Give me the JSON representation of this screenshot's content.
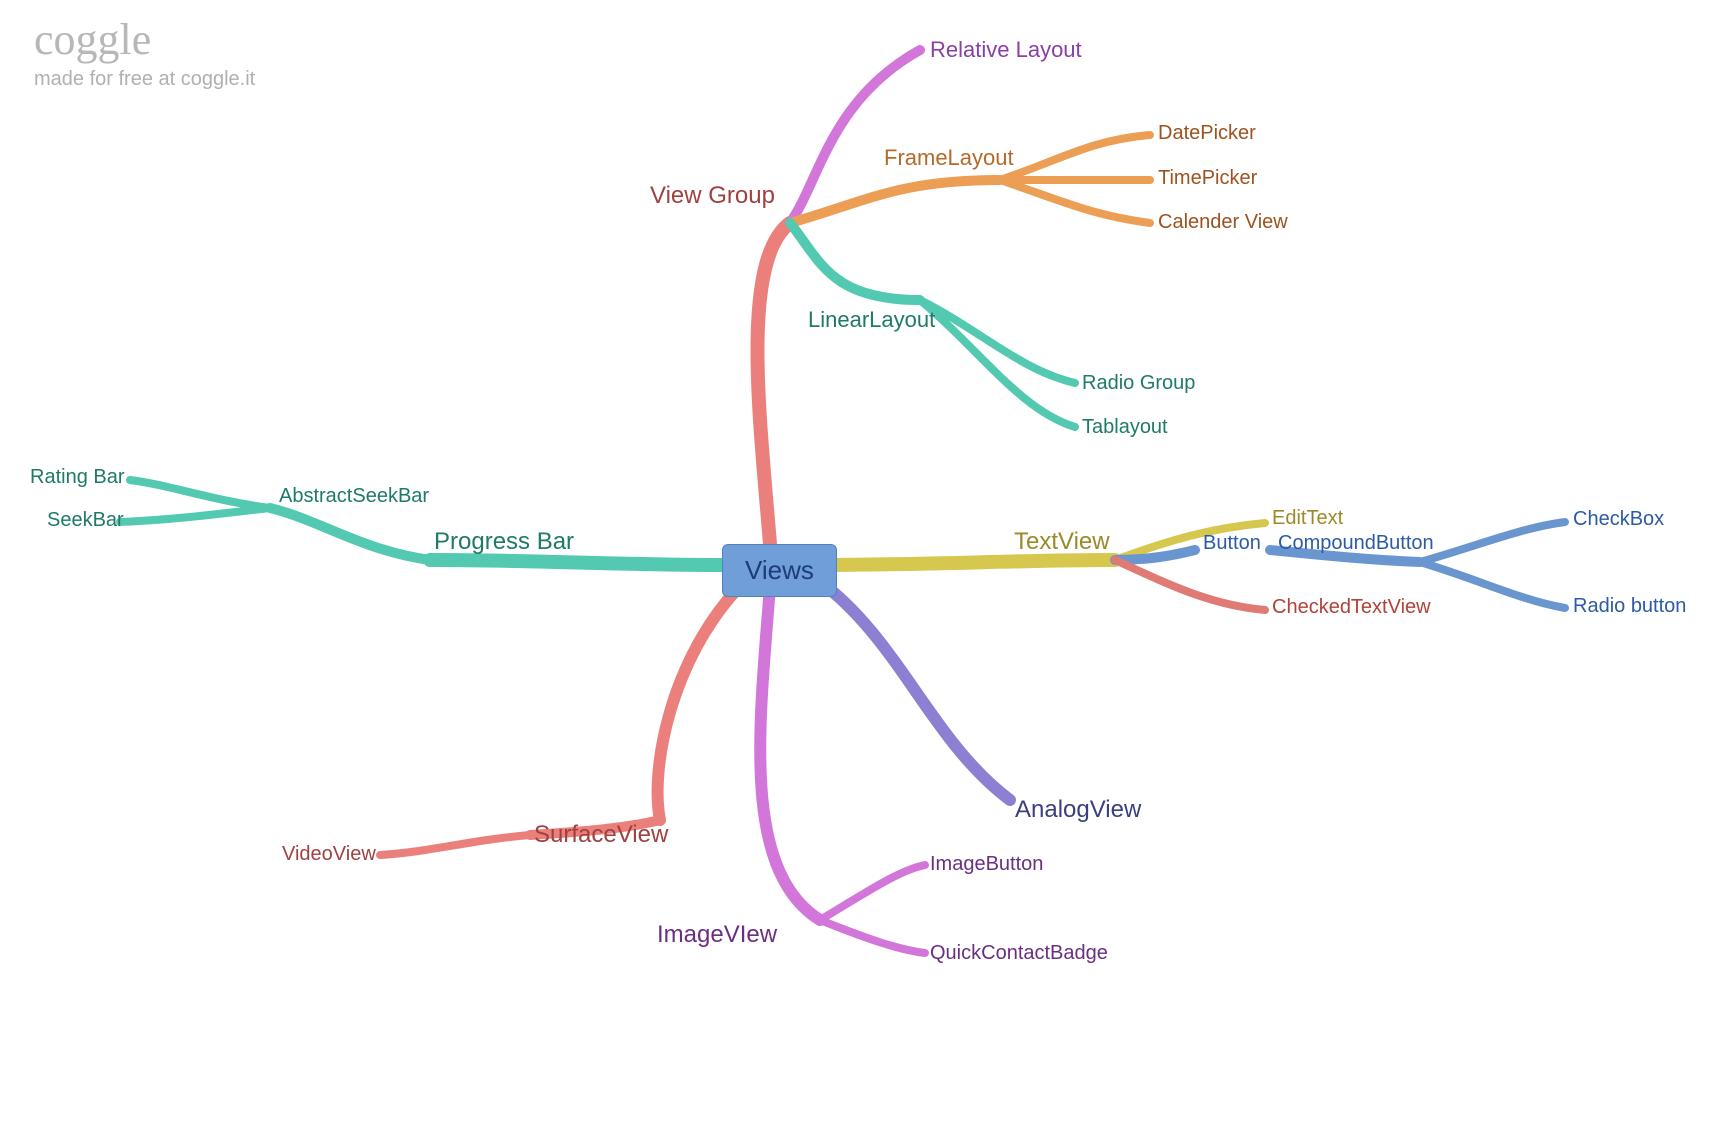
{
  "watermark": {
    "brand": "coggle",
    "subtitle": "made for free at coggle.it"
  },
  "root": {
    "label": "Views"
  },
  "colors": {
    "red": "#eb7f7b",
    "teal": "#52c9b0",
    "yellow": "#d6c84f",
    "blue": "#6a96d0",
    "orange": "#ec9e55",
    "purple": "#8d7fd2",
    "pink": "#d276d9",
    "redline": "#e07a74"
  },
  "nodes": {
    "view_group": {
      "label": "View Group",
      "color": "#9e4141"
    },
    "relative_layout": {
      "label": "Relative Layout",
      "color": "#8a3fa5"
    },
    "frame_layout": {
      "label": "FrameLayout",
      "color": "#b56a2a"
    },
    "date_picker": {
      "label": "DatePicker",
      "color": "#9e5220"
    },
    "time_picker": {
      "label": "TimePicker",
      "color": "#9e5220"
    },
    "calendar_view": {
      "label": "Calender View",
      "color": "#9e5220"
    },
    "linear_layout": {
      "label": "LinearLayout",
      "color": "#1f7a68"
    },
    "radio_group": {
      "label": "Radio Group",
      "color": "#1f7a68"
    },
    "tab_layout": {
      "label": "Tablayout",
      "color": "#1f7a68"
    },
    "text_view": {
      "label": "TextView",
      "color": "#9a8a2a"
    },
    "edit_text": {
      "label": "EditText",
      "color": "#9a8a2a"
    },
    "button": {
      "label": "Button",
      "color": "#2d5aa5"
    },
    "compound_button": {
      "label": "CompoundButton",
      "color": "#2d5aa5"
    },
    "checkbox": {
      "label": "CheckBox",
      "color": "#2d5aa5"
    },
    "radio_button": {
      "label": "Radio button",
      "color": "#2d5aa5"
    },
    "checked_text_view": {
      "label": "CheckedTextView",
      "color": "#b04238"
    },
    "analog_view": {
      "label": "AnalogView",
      "color": "#3a3f80"
    },
    "image_view": {
      "label": "ImageVIew",
      "color": "#6a2f82"
    },
    "image_button": {
      "label": "ImageButton",
      "color": "#6a2f82"
    },
    "quick_contact_badge": {
      "label": "QuickContactBadge",
      "color": "#6a2f82"
    },
    "surface_view": {
      "label": "SurfaceView",
      "color": "#9e4141"
    },
    "video_view": {
      "label": "VideoView",
      "color": "#9e4141"
    },
    "progress_bar": {
      "label": "Progress Bar",
      "color": "#1f7a68"
    },
    "abstract_seek_bar": {
      "label": "AbstractSeekBar",
      "color": "#1f7a68"
    },
    "rating_bar": {
      "label": "Rating Bar",
      "color": "#1f7a68"
    },
    "seek_bar": {
      "label": "SeekBar",
      "color": "#1f7a68"
    }
  }
}
